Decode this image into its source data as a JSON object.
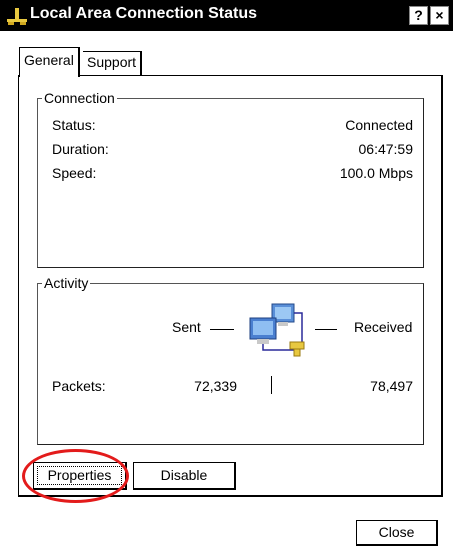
{
  "window": {
    "title": "Local Area Connection Status",
    "help_label": "?",
    "close_label": "×"
  },
  "tabs": [
    {
      "label": "General",
      "selected": true
    },
    {
      "label": "Support",
      "selected": false
    }
  ],
  "connection": {
    "legend": "Connection",
    "rows": [
      {
        "label": "Status:",
        "value": "Connected"
      },
      {
        "label": "Duration:",
        "value": "06:47:59"
      },
      {
        "label": "Speed:",
        "value": "100.0 Mbps"
      }
    ]
  },
  "activity": {
    "legend": "Activity",
    "sent_label": "Sent",
    "received_label": "Received",
    "packets_label": "Packets:",
    "packets_sent": "72,339",
    "packets_received": "78,497"
  },
  "buttons": {
    "properties": "Properties",
    "disable": "Disable",
    "close": "Close"
  },
  "icons": {
    "title_icon": "network-connection-icon",
    "activity_icon": "network-computers-icon"
  },
  "colors": {
    "highlight": "#e31b1b"
  }
}
